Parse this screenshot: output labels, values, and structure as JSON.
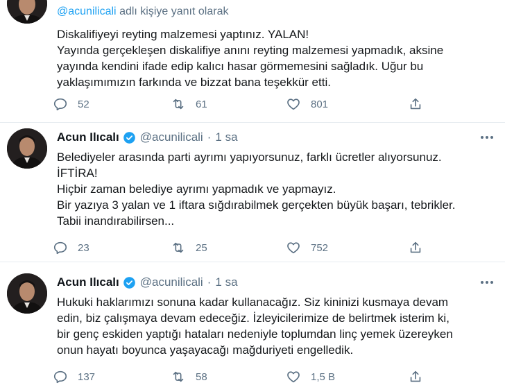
{
  "tweets": [
    {
      "reply_handle": "@acunilicali",
      "reply_suffix": "adlı kişiye yanıt olarak",
      "lines": [
        "Diskalifiyeyi reyting malzemesi yaptınız. YALAN!",
        "Yayında gerçekleşen diskalifiye anını reyting malzemesi yapmadık, aksine",
        "yayında kendini ifade edip kalıcı hasar görmemesini sağladık. Uğur bu",
        "yaklaşımımızın farkında ve bizzat bana teşekkür etti."
      ],
      "replies": "52",
      "retweets": "61",
      "likes": "801"
    },
    {
      "name": "Acun Ilıcalı",
      "handle": "@acunilicali",
      "dot": "·",
      "time": "1 sa",
      "lines": [
        "Belediyeler arasında parti ayrımı yapıyorsunuz, farklı ücretler alıyorsunuz.",
        "İFTİRA!",
        "Hiçbir zaman belediye ayrımı yapmadık ve yapmayız.",
        "Bir yazıya 3 yalan ve 1 iftara sığdırabilmek gerçekten büyük başarı, tebrikler.",
        "Tabii inandırabilirsen..."
      ],
      "replies": "23",
      "retweets": "25",
      "likes": "752"
    },
    {
      "name": "Acun Ilıcalı",
      "handle": "@acunilicali",
      "dot": "·",
      "time": "1 sa",
      "lines": [
        "Hukuki haklarımızı sonuna kadar kullanacağız. Siz kininizi kusmaya devam",
        "edin, biz çalışmaya devam edeceğiz. İzleyicilerimize de belirtmek isterim ki,",
        "bir genç eskiden yaptığı hataları nedeniyle toplumdan linç yemek üzereyken",
        "onun hayatı boyunca yaşayacağı mağduriyeti engelledik."
      ],
      "replies": "137",
      "retweets": "58",
      "likes": "1,5 B"
    }
  ],
  "colors": {
    "text": "#14171a",
    "secondary": "#5b7083",
    "link": "#1da1f2",
    "verified": "#1da1f2",
    "separator": "#e6ecf0"
  },
  "icons": [
    "reply-icon",
    "retweet-icon",
    "like-icon",
    "share-icon",
    "verified-badge-icon",
    "more-icon"
  ]
}
